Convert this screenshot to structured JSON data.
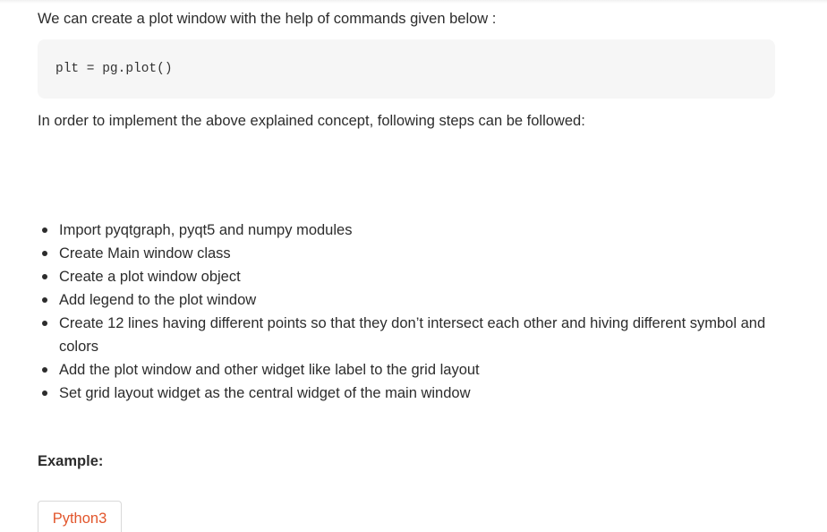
{
  "content": {
    "intro_text": "We can create a plot window with the help of commands given below :",
    "code_snippet": "plt = pg.plot()",
    "steps_intro": "In order to implement the above explained concept, following steps can be followed:",
    "steps": [
      " Import pyqtgraph, pyqt5 and numpy modules",
      "Create Main window class",
      "Create a plot window object",
      "Add legend to the plot window",
      "Create 12 lines having different points so that they don’t intersect each other and hiving different symbol and colors",
      "Add the plot window and other widget like label to the grid layout",
      "Set grid layout widget as the central widget of the main window"
    ],
    "example_heading": "Example:",
    "language_tab": "Python3"
  },
  "colors": {
    "text": "#2c2c2c",
    "code_background": "#f6f6f6",
    "tab_accent": "#e2552b",
    "tab_border": "#d9d9d9"
  }
}
